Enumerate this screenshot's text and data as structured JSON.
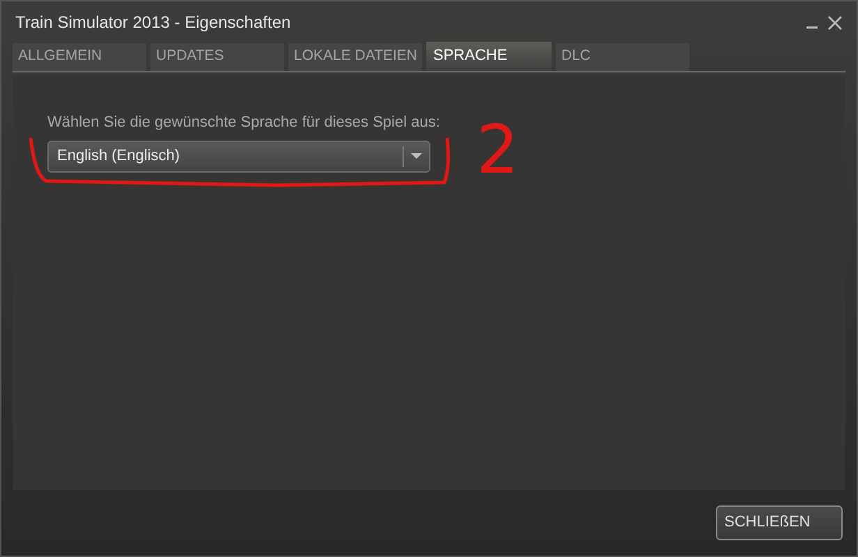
{
  "window": {
    "title": "Train Simulator 2013 - Eigenschaften"
  },
  "tabs": [
    {
      "label": "ALLGEMEIN",
      "selected": false
    },
    {
      "label": "UPDATES",
      "selected": false
    },
    {
      "label": "LOKALE DATEIEN",
      "selected": false
    },
    {
      "label": "SPRACHE",
      "selected": true
    },
    {
      "label": "DLC",
      "selected": false
    }
  ],
  "language": {
    "prompt": "Wählen Sie die gewünschte Sprache für dieses Spiel aus:",
    "value": "English (Englisch)"
  },
  "annotation": {
    "label": "2"
  },
  "buttons": [
    "SCHLIEßEN"
  ]
}
